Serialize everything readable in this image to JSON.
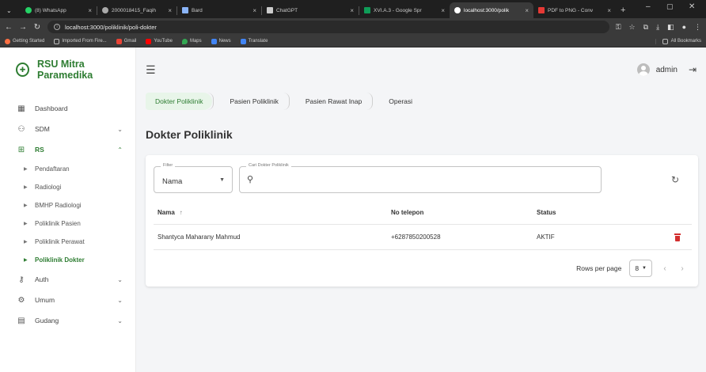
{
  "browser": {
    "tabs": [
      {
        "label": "(8) WhatsApp",
        "color": "#25d366",
        "active": false
      },
      {
        "label": "2000018415_Faqih",
        "color": "#aaaaaa",
        "active": false
      },
      {
        "label": "Bard",
        "color": "#8ab4f8",
        "active": false
      },
      {
        "label": "ChatGPT",
        "color": "#cccccc",
        "active": false
      },
      {
        "label": "XVI.A.3 - Google Spr",
        "color": "#0f9d58",
        "active": false
      },
      {
        "label": "localhost:3000/polik",
        "color": "#ffffff",
        "active": true
      },
      {
        "label": "PDF to PNG - Conv",
        "color": "#e53935",
        "active": false
      }
    ],
    "new_tab": "+",
    "url": "localhost:3000/poliklinik/poli-dokter",
    "bookmarks": [
      {
        "label": "Getting Started",
        "color": "#ff7043"
      },
      {
        "label": "Imported From Fire...",
        "color": "#9e9e9e"
      },
      {
        "label": "Gmail",
        "color": "#ea4335"
      },
      {
        "label": "YouTube",
        "color": "#ff0000"
      },
      {
        "label": "Maps",
        "color": "#34a853"
      },
      {
        "label": "News",
        "color": "#4285f4"
      },
      {
        "label": "Translate",
        "color": "#4285f4"
      }
    ],
    "all_bookmarks": "All Bookmarks"
  },
  "sidebar": {
    "brand": "RSU Mitra Paramedika",
    "items": [
      {
        "label": "Dashboard",
        "icon": "grid"
      },
      {
        "label": "SDM",
        "icon": "people"
      },
      {
        "label": "RS",
        "icon": "plus-box"
      },
      {
        "label": "Auth",
        "icon": "key"
      },
      {
        "label": "Umum",
        "icon": "gear"
      },
      {
        "label": "Gudang",
        "icon": "archive"
      }
    ],
    "rs_subitems": [
      "Pendaftaran",
      "Radiologi",
      "BMHP Radiologi",
      "Poliklinik Pasien",
      "Poliklinik Perawat",
      "Poliklinik Dokter"
    ]
  },
  "topbar": {
    "user": "admin"
  },
  "breadcrumbs": [
    "Dokter Poliklinik",
    "Pasien Poliklinik",
    "Pasien Rawat Inap",
    "Operasi"
  ],
  "page": {
    "title": "Dokter Poliklinik"
  },
  "filter": {
    "legend": "Filter",
    "value": "Nama"
  },
  "search": {
    "legend": "Cari Dokter Poliklinik",
    "value": ""
  },
  "table": {
    "headers": [
      "Nama",
      "No telepon",
      "Status"
    ],
    "rows": [
      {
        "nama": "Shantyca Maharany Mahmud",
        "telepon": "+6287850200528",
        "status": "AKTIF"
      }
    ]
  },
  "pager": {
    "label": "Rows per page",
    "value": "8"
  },
  "colors": {
    "accent": "#2e7d32",
    "accent_bg": "#e8f5e9",
    "danger": "#d32f2f"
  }
}
